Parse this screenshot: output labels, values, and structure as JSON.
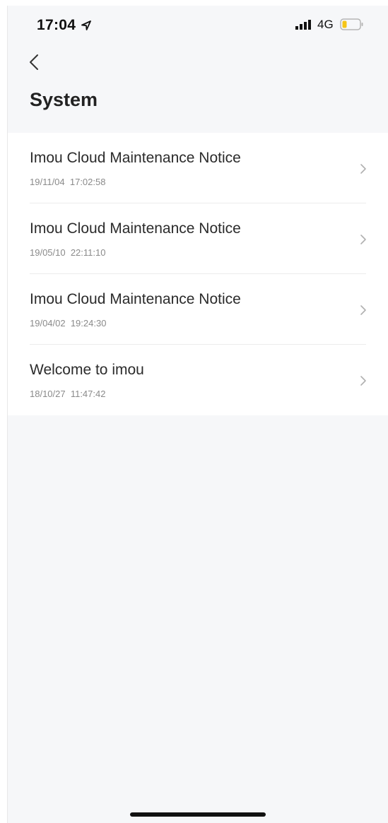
{
  "status_bar": {
    "time": "17:04",
    "network": "4G",
    "icons": [
      "location-arrow-icon",
      "cellular-signal-icon",
      "battery-low-icon"
    ],
    "battery_color": "#f5c518"
  },
  "nav": {
    "back_icon": "chevron-left-icon"
  },
  "page": {
    "title": "System"
  },
  "messages": [
    {
      "title": "Imou Cloud Maintenance Notice",
      "time": "19/11/04  17:02:58"
    },
    {
      "title": "Imou Cloud Maintenance Notice",
      "time": "19/05/10  22:11:10"
    },
    {
      "title": "Imou Cloud Maintenance Notice",
      "time": "19/04/02  19:24:30"
    },
    {
      "title": "Welcome to imou",
      "time": "18/10/27  11:47:42"
    }
  ],
  "colors": {
    "background": "#f6f7f9",
    "list_background": "#ffffff",
    "title_text": "#2b2b2b",
    "time_text": "#8a8a8a"
  }
}
